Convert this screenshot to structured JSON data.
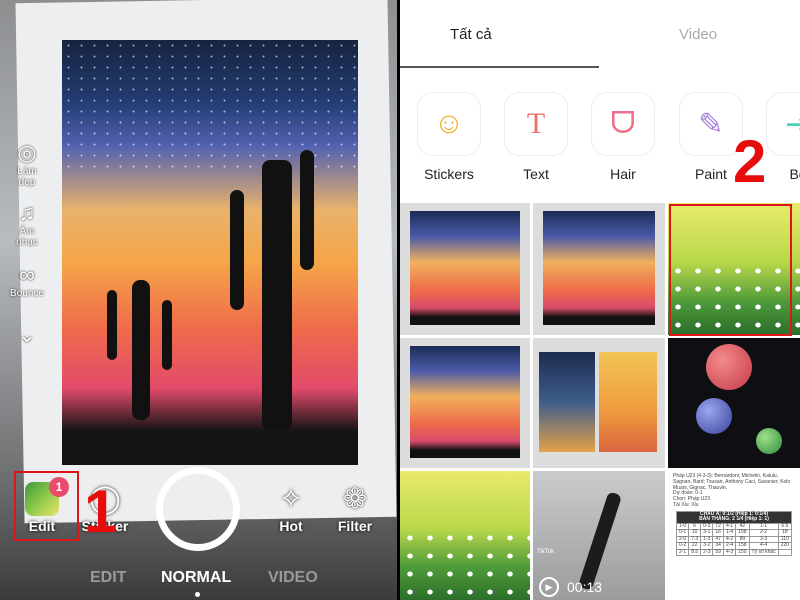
{
  "left_panel": {
    "side_tools": [
      {
        "icon": "beauty-icon",
        "label": "Làm đẹp"
      },
      {
        "icon": "music-icon",
        "label": "Âm nhạc"
      },
      {
        "icon": "bounce-icon",
        "label": "Bounce"
      }
    ],
    "bottom_tools": [
      {
        "icon": "edit-thumbnail",
        "label": "Edit",
        "badge": "1"
      },
      {
        "icon": "sticker-icon",
        "label": "Sticker"
      },
      {
        "icon": "sparkle-icon",
        "label": "Hot"
      },
      {
        "icon": "filter-icon",
        "label": "Filter"
      }
    ],
    "modes": [
      "EDIT",
      "NORMAL",
      "VIDEO"
    ],
    "active_mode": "NORMAL",
    "annotation": "1"
  },
  "right_panel": {
    "tabs": [
      {
        "label": "Tất cả",
        "active": true
      },
      {
        "label": "Video",
        "active": false
      }
    ],
    "features": [
      {
        "icon": "smiley-icon",
        "label": "Stickers",
        "color": "#f2b233"
      },
      {
        "icon": "text-icon",
        "label": "Text",
        "color": "#ef6d6d"
      },
      {
        "icon": "hair-icon",
        "label": "Hair",
        "color": "#ee6f88"
      },
      {
        "icon": "paint-icon",
        "label": "Paint",
        "color": "#a77ee0"
      },
      {
        "icon": "body-icon",
        "label": "Bo",
        "color": "#3fcfb0"
      }
    ],
    "annotation": "2",
    "video": {
      "brand": "TikTok",
      "duration": "00:13"
    },
    "document": {
      "lines": [
        "Pháp U23 (4-3-3): Bernardoni; Michelin, Kalulu, Sagnan, Bard; Tousart, Anthony Caci, Savanier; Kolo Muani, Gignac, Thauvin.",
        "Dự đoán: 0-1",
        "Chọn: Pháp U23",
        "Tài Xỉu: Xỉu"
      ],
      "table_header": [
        "CHÂU Á: 0:1/2 (Hiệp 1: 0:1/4)",
        "BÀN THẮNG: 2 1/4 (Hiệp 1: 1)"
      ],
      "table_rows": [
        [
          "1-0",
          "6",
          "0-3",
          "72",
          "4-1",
          "42",
          "1-1",
          "6.5"
        ],
        [
          "0-1",
          "10",
          "3-1",
          "16",
          "1-4",
          "158",
          "2-2",
          "18"
        ],
        [
          "2-0",
          "7.3",
          "1-3",
          "47",
          "4-2",
          "89",
          "3-3",
          "110"
        ],
        [
          "0-2",
          "22",
          "3-2",
          "34",
          "2-4",
          "158",
          "4-4",
          "220"
        ],
        [
          "2-1",
          "8.5",
          "2-3",
          "59",
          "4-3",
          "150",
          "Tỷ số khác",
          ""
        ]
      ]
    }
  },
  "colors": {
    "annotation_red": "#e0141b",
    "badge_pink": "#e94b6c"
  }
}
